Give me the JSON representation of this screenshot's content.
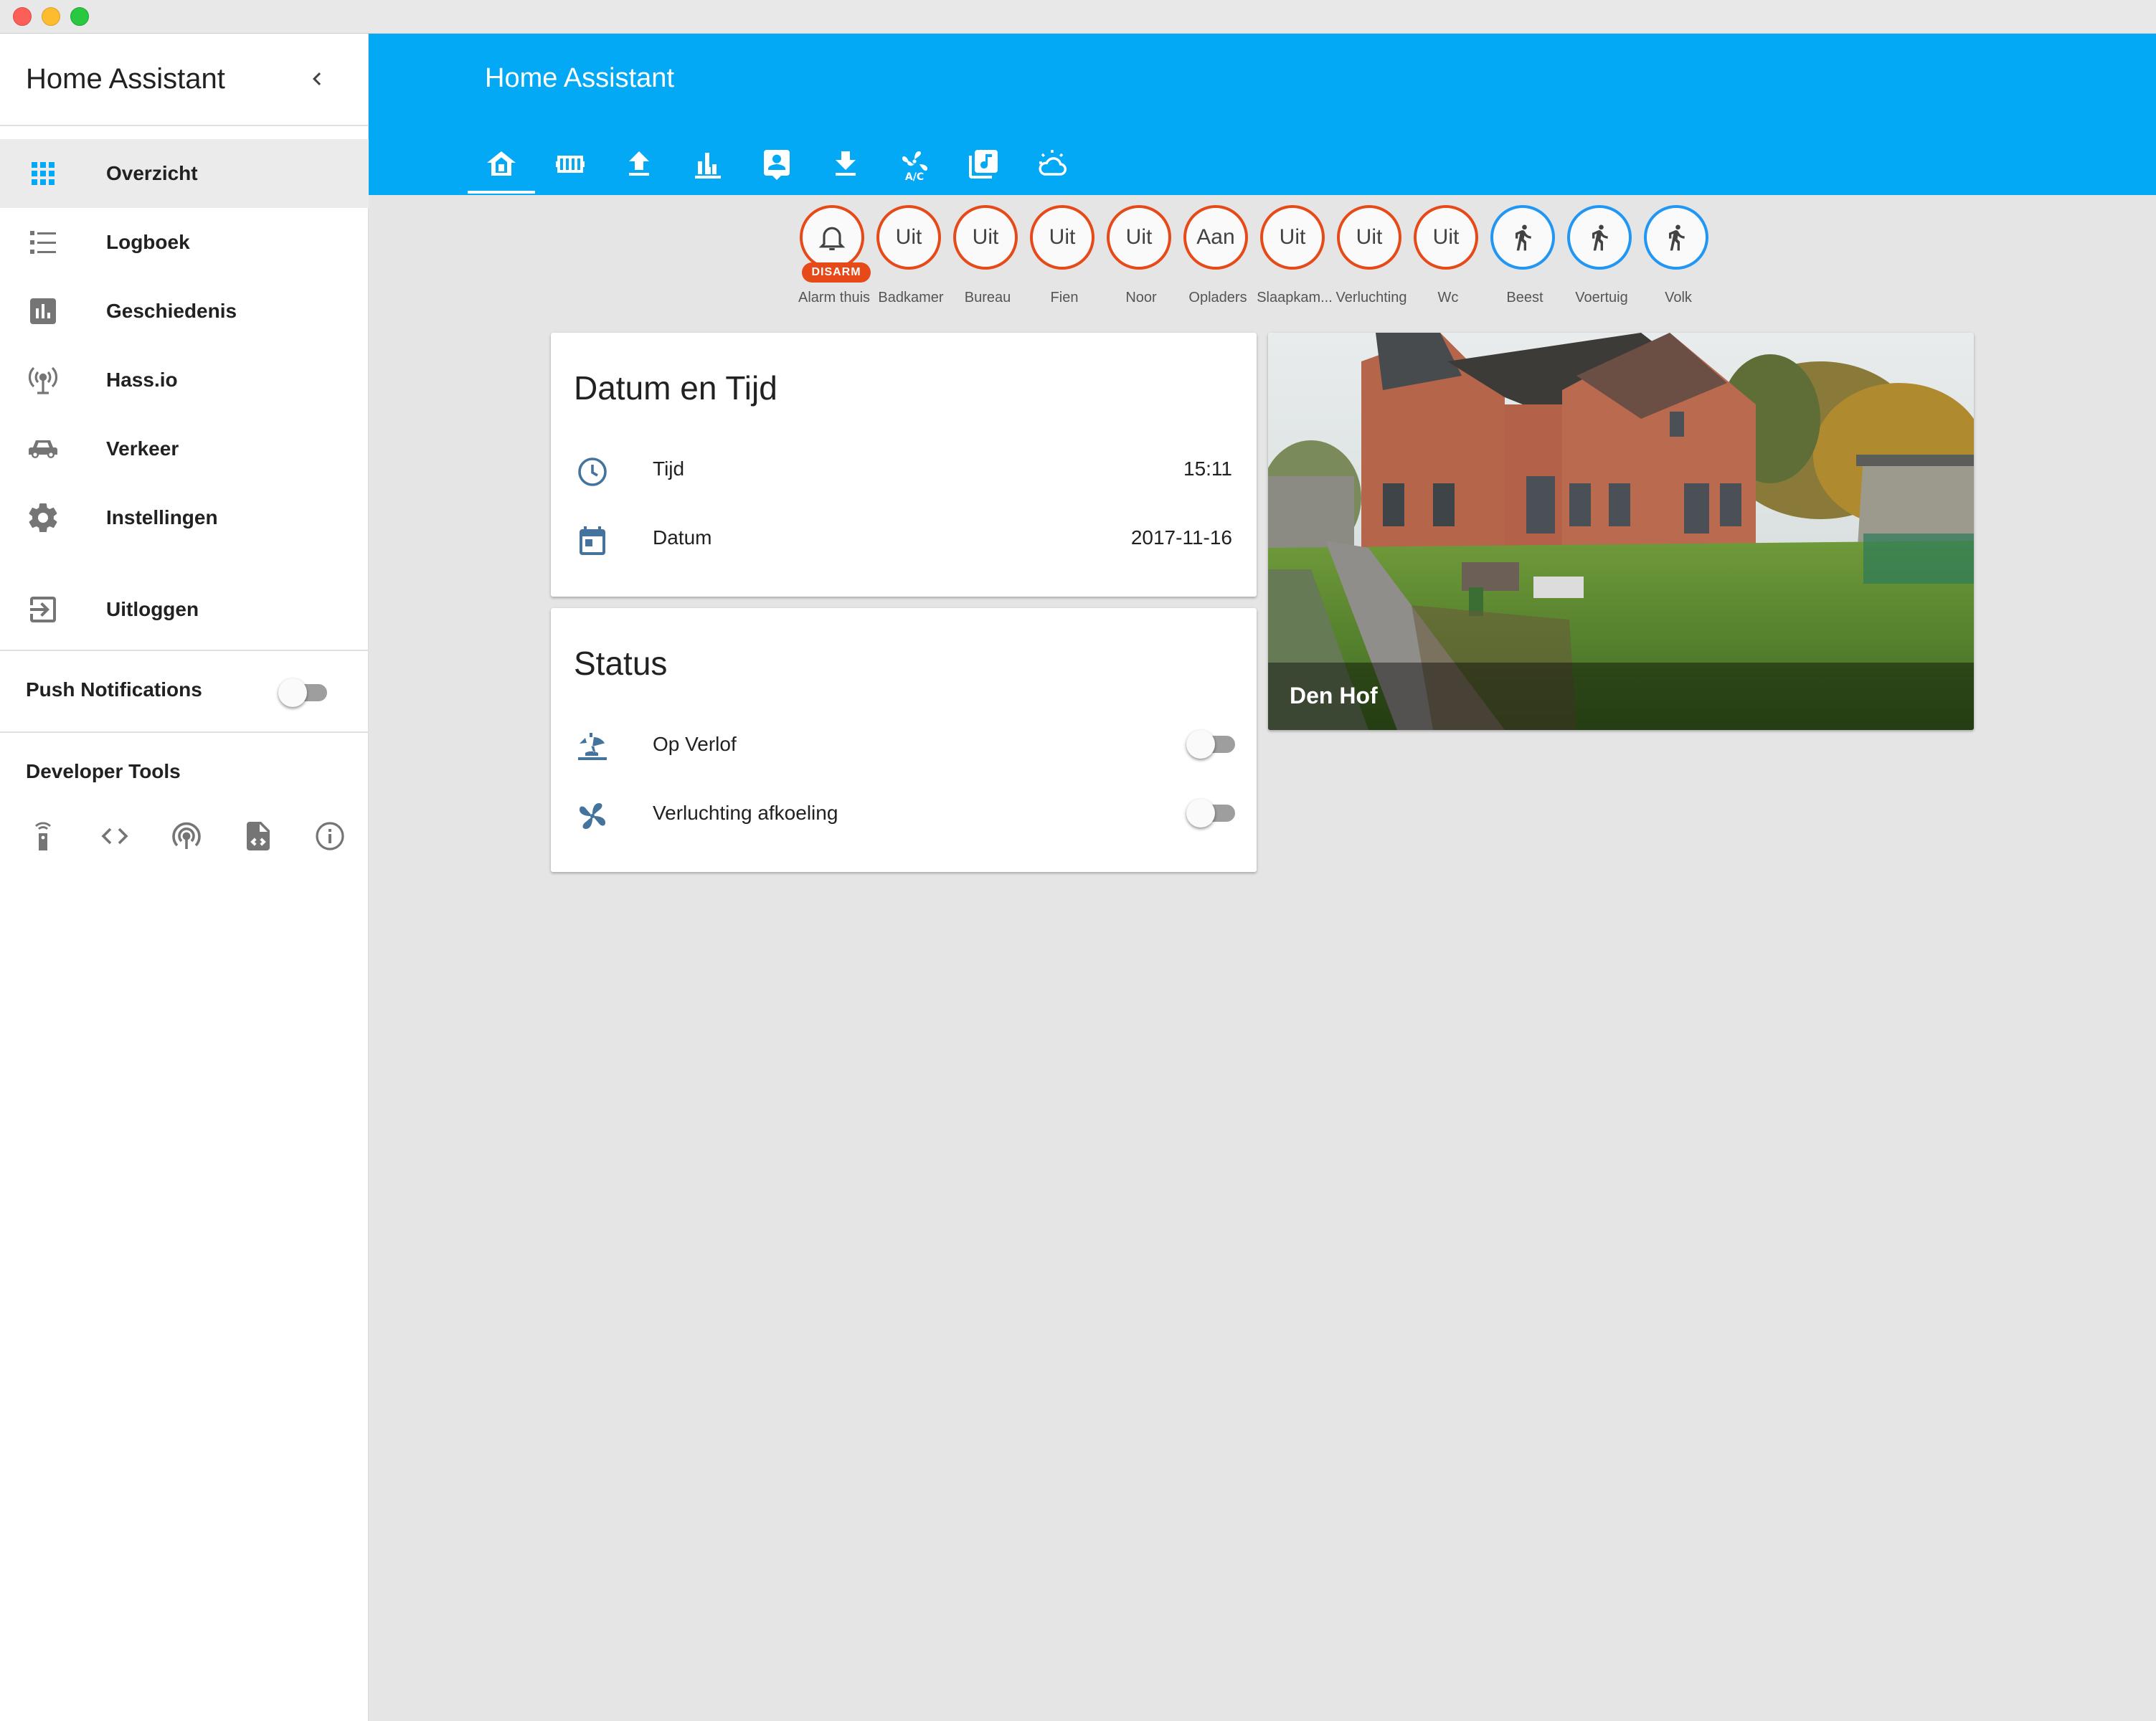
{
  "window": {
    "traffic_lights": [
      "close",
      "minimize",
      "maximize"
    ]
  },
  "sidebar": {
    "title": "Home Assistant",
    "items": [
      {
        "label": "Overzicht",
        "icon": "grid-icon",
        "active": true
      },
      {
        "label": "Logboek",
        "icon": "list-icon"
      },
      {
        "label": "Geschiedenis",
        "icon": "chart-icon"
      },
      {
        "label": "Hass.io",
        "icon": "antenna-icon"
      },
      {
        "label": "Verkeer",
        "icon": "car-icon"
      },
      {
        "label": "Instellingen",
        "icon": "gear-icon"
      }
    ],
    "logout_label": "Uitloggen",
    "push_notifications_label": "Push Notifications",
    "push_notifications_on": false,
    "developer_tools_label": "Developer Tools",
    "developer_tools_icons": [
      "remote-icon",
      "code-icon",
      "broadcast-icon",
      "file-code-icon",
      "info-icon"
    ]
  },
  "header": {
    "title": "Home Assistant",
    "tabs": [
      "home-icon",
      "radiator-icon",
      "upload-icon",
      "bar-chart-icon",
      "contact-icon",
      "download-icon",
      "fan-ac-icon",
      "music-library-icon",
      "weather-icon"
    ],
    "active_tab": 0
  },
  "badges": [
    {
      "value": "",
      "label": "Alarm thuis",
      "icon": "bell-icon",
      "tag": "DISARM",
      "color": "#e64a19"
    },
    {
      "value": "Uit",
      "label": "Badkamer",
      "color": "#e64a19"
    },
    {
      "value": "Uit",
      "label": "Bureau",
      "color": "#e64a19"
    },
    {
      "value": "Uit",
      "label": "Fien",
      "color": "#e64a19"
    },
    {
      "value": "Uit",
      "label": "Noor",
      "color": "#e64a19"
    },
    {
      "value": "Aan",
      "label": "Opladers",
      "color": "#e64a19"
    },
    {
      "value": "Uit",
      "label": "Slaapkam...",
      "color": "#e64a19"
    },
    {
      "value": "Uit",
      "label": "Verluchting",
      "color": "#e64a19"
    },
    {
      "value": "Uit",
      "label": "Wc",
      "color": "#e64a19"
    },
    {
      "value": "",
      "label": "Beest",
      "icon": "walk-icon",
      "color": "#2196f3"
    },
    {
      "value": "",
      "label": "Voertuig",
      "icon": "walk-icon",
      "color": "#2196f3"
    },
    {
      "value": "",
      "label": "Volk",
      "icon": "walk-icon",
      "color": "#2196f3"
    }
  ],
  "datetime_card": {
    "title": "Datum en Tijd",
    "rows": [
      {
        "label": "Tijd",
        "value": "15:11",
        "icon": "clock-icon"
      },
      {
        "label": "Datum",
        "value": "2017-11-16",
        "icon": "calendar-icon"
      }
    ]
  },
  "status_card": {
    "title": "Status",
    "rows": [
      {
        "label": "Op Verlof",
        "icon": "beach-icon",
        "on": false
      },
      {
        "label": "Verluchting afkoeling",
        "icon": "fan-icon",
        "on": false
      }
    ]
  },
  "camera_card": {
    "name": "Den Hof"
  },
  "colors": {
    "primary": "#03a9f4",
    "accent_off": "#e64a19",
    "accent_person": "#2196f3",
    "icon_blue": "#44739e",
    "sidebar_icon": "#757575",
    "background": "#e5e5e5"
  }
}
